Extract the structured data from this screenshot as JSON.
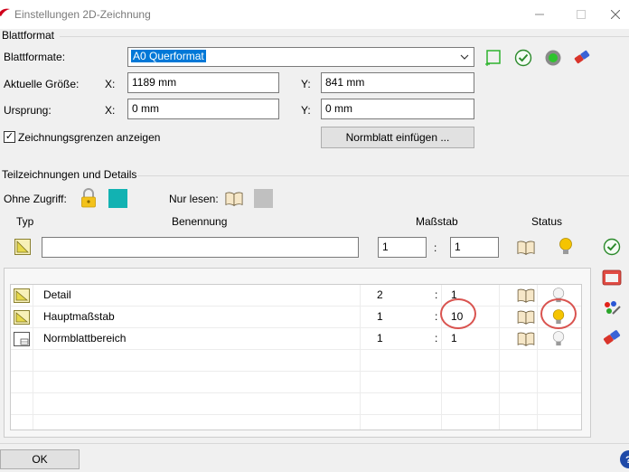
{
  "window": {
    "title": "Einstellungen 2D-Zeichnung",
    "minimize_icon": "minimize-icon",
    "maximize_icon": "maximize-icon",
    "close_icon": "close-icon"
  },
  "blattformat": {
    "section_label": "Blattformat",
    "formate_label": "Blattformate:",
    "formate_value": "A0 Querformat",
    "groesse_label": "Aktuelle Größe:",
    "x_label": "X:",
    "y_label": "Y:",
    "groesse_x": "1189 mm",
    "groesse_y": "841 mm",
    "ursprung_label": "Ursprung:",
    "ursprung_x": "0 mm",
    "ursprung_y": "0 mm",
    "grenzen_label": "Zeichnungsgrenzen anzeigen",
    "grenzen_checked": true,
    "normblatt_button": "Normblatt einfügen ..."
  },
  "teilzeichnungen": {
    "section_label": "Teilzeichnungen und Details",
    "ohne_zugriff_label": "Ohne Zugriff:",
    "nur_lesen_label": "Nur lesen:",
    "ohne_zugriff_color": "#12b2b2",
    "nur_lesen_color": "#c0c0c0",
    "columns": {
      "typ": "Typ",
      "benennung": "Benennung",
      "massstab": "Maßstab",
      "status": "Status"
    },
    "new_entry": {
      "name": "",
      "scale_left": "1",
      "colon": ":",
      "scale_right": "1"
    },
    "rows": [
      {
        "name": "Detail",
        "scale_left": "2",
        "colon": ":",
        "scale_right": "1",
        "status": "bulb-off-icon"
      },
      {
        "name": "Hauptmaßstab",
        "scale_left": "1",
        "colon": ":",
        "scale_right": "10",
        "status": "bulb-on-icon"
      },
      {
        "name": "Normblattbereich",
        "scale_left": "1",
        "colon": ":",
        "scale_right": "1",
        "status": "bulb-off-icon"
      }
    ]
  },
  "footer": {
    "ok_button": "OK"
  },
  "colors": {
    "accent": "#0078d7",
    "highlight_circle": "#d9534f",
    "bulb_on": "#f5c400"
  }
}
